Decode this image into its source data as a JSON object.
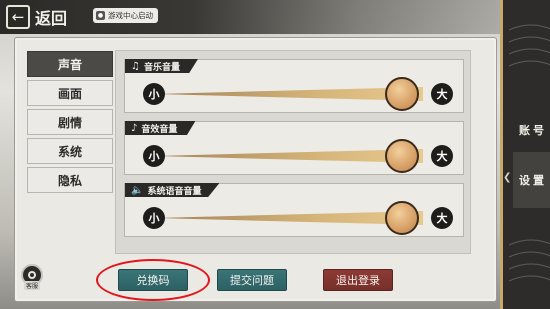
{
  "header": {
    "back_label": "返回",
    "launch_badge": "游戏中心启动"
  },
  "tabs": [
    {
      "label": "声音",
      "active": true
    },
    {
      "label": "画面",
      "active": false
    },
    {
      "label": "剧情",
      "active": false
    },
    {
      "label": "系统",
      "active": false
    },
    {
      "label": "隐私",
      "active": false
    }
  ],
  "volume": {
    "min_label": "小",
    "max_label": "大",
    "sliders": [
      {
        "label": "音乐音量",
        "icon": "music-note-icon",
        "level": 0.92
      },
      {
        "label": "音效音量",
        "icon": "music-note-icon",
        "level": 0.92
      },
      {
        "label": "系统语音音量",
        "icon": "speaker-icon",
        "level": 0.92
      }
    ]
  },
  "footer": {
    "kefu_label": "客服",
    "redeem_label": "兑换码",
    "feedback_label": "提交问题",
    "logout_label": "退出登录"
  },
  "side_nav": {
    "account_label": "账号",
    "settings_label": "设置"
  },
  "colors": {
    "active_tab": "#4b4a47",
    "teal_button": "#2d6164",
    "red_button": "#76302b",
    "highlight": "#e3141a",
    "knob": "#d9a36a"
  }
}
